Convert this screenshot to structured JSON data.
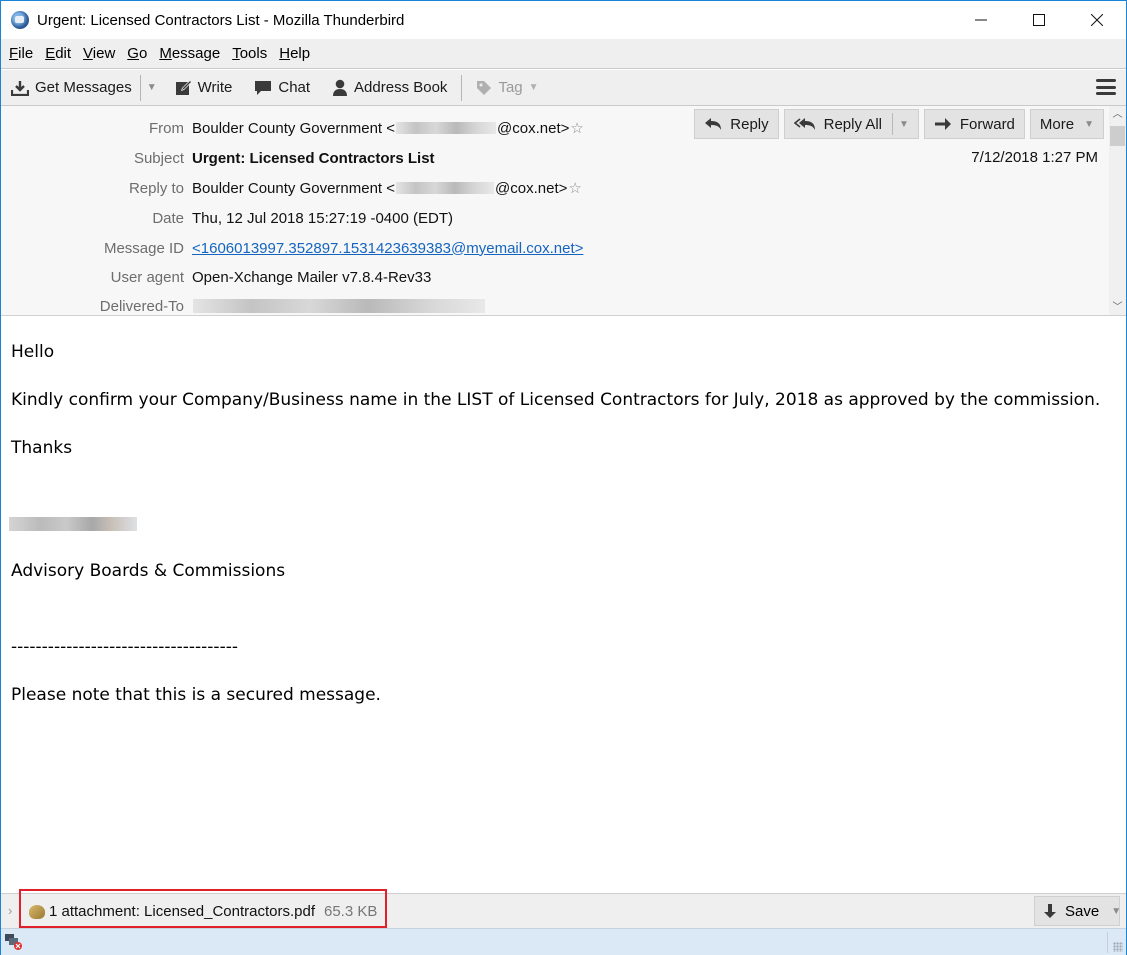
{
  "window": {
    "title": "Urgent: Licensed Contractors List - Mozilla Thunderbird",
    "controls": {
      "minimize": "—",
      "maximize": "☐",
      "close": "✕"
    }
  },
  "menubar": [
    {
      "label": "File",
      "accel": "F",
      "rest": "ile"
    },
    {
      "label": "Edit",
      "accel": "E",
      "rest": "dit"
    },
    {
      "label": "View",
      "accel": "V",
      "rest": "iew"
    },
    {
      "label": "Go",
      "accel": "G",
      "rest": "o"
    },
    {
      "label": "Message",
      "accel": "M",
      "rest": "essage"
    },
    {
      "label": "Tools",
      "accel": "T",
      "rest": "ools"
    },
    {
      "label": "Help",
      "accel": "H",
      "rest": "elp"
    }
  ],
  "toolbar": {
    "get_messages": "Get Messages",
    "write": "Write",
    "chat": "Chat",
    "address_book": "Address Book",
    "tag": "Tag"
  },
  "header": {
    "actions": {
      "reply": "Reply",
      "reply_all": "Reply All",
      "forward": "Forward",
      "more": "More"
    },
    "date_short": "7/12/2018 1:27 PM",
    "fields": {
      "from": {
        "label": "From",
        "name": "Boulder County Government <",
        "domain": "@cox.net>"
      },
      "subject": {
        "label": "Subject",
        "value": "Urgent: Licensed Contractors List"
      },
      "reply_to": {
        "label": "Reply to",
        "name": "Boulder County Government <",
        "domain": "@cox.net>"
      },
      "date": {
        "label": "Date",
        "value": "Thu, 12 Jul 2018 15:27:19 -0400 (EDT)"
      },
      "message_id": {
        "label": "Message ID",
        "value": "<1606013997.352897.1531423639383@myemail.cox.net>"
      },
      "user_agent": {
        "label": "User agent",
        "value": "Open-Xchange Mailer v7.8.4-Rev33"
      },
      "delivered_to": {
        "label": "Delivered-To"
      }
    }
  },
  "body": {
    "greeting": "Hello",
    "paragraph": "Kindly confirm your Company/Business name in the LIST of Licensed Contractors for July, 2018 as approved by the commission.",
    "thanks": "Thanks",
    "department": "Advisory Boards & Commissions",
    "divider": "-------------------------------------",
    "note": "Please note that this is a secured message."
  },
  "attachment": {
    "toggle": "›",
    "summary": "1 attachment: Licensed_Contractors.pdf",
    "size": "65.3 KB",
    "save_label": "Save",
    "highlight_color": "#e0202a"
  },
  "colors": {
    "link": "#1565c0",
    "statusbar": "#dbe8f5",
    "window_border": "#1883d7"
  }
}
